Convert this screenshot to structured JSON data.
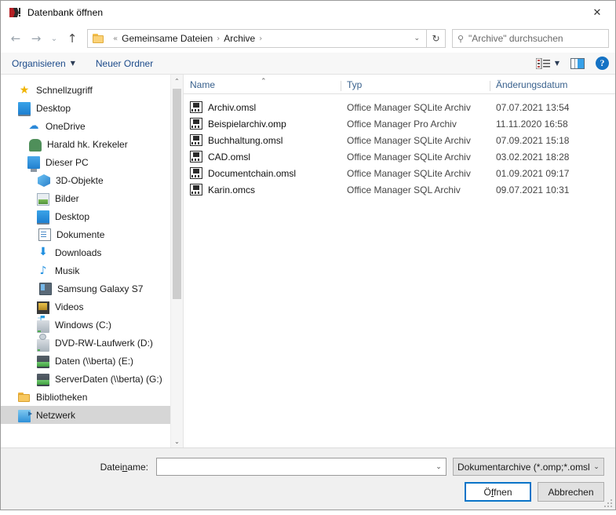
{
  "window": {
    "title": "Datenbank öffnen",
    "app_icon": "office-manager-icon",
    "close_label": "✕"
  },
  "nav": {
    "back_label": "←",
    "forward_label": "→",
    "recent_label": "⌄",
    "up_label": "↑",
    "refresh_label": "↻",
    "dropdown_label": "⌄",
    "breadcrumb": {
      "overflow": "«",
      "separator": "›",
      "items": [
        "Gemeinsame Dateien",
        "Archive"
      ]
    }
  },
  "search": {
    "placeholder": "\"Archive\" durchsuchen",
    "value": "",
    "icon": "search-icon"
  },
  "toolbar": {
    "organize_label": "Organisieren",
    "organize_caret": "▼",
    "new_folder_label": "Neuer Ordner",
    "view_options_icon": "view-options-icon",
    "view_caret": "▼",
    "preview_pane_icon": "preview-pane-icon",
    "help_label": "?"
  },
  "sidebar": {
    "scroll_up": "⌃",
    "scroll_down": "⌄",
    "items": [
      {
        "label": "Schnellzugriff",
        "icon": "quick-access-star-icon",
        "level": 0,
        "selected": false
      },
      {
        "label": "Desktop",
        "icon": "desktop-monitor-icon",
        "level": 0,
        "selected": false
      },
      {
        "label": "OneDrive",
        "icon": "onedrive-cloud-icon",
        "level": 1,
        "selected": false
      },
      {
        "label": "Harald hk. Krekeler",
        "icon": "user-person-icon",
        "level": 1,
        "selected": false
      },
      {
        "label": "Dieser PC",
        "icon": "this-pc-icon",
        "level": 1,
        "selected": false
      },
      {
        "label": "3D-Objekte",
        "icon": "3d-objects-icon",
        "level": 2,
        "selected": false
      },
      {
        "label": "Bilder",
        "icon": "pictures-icon",
        "level": 2,
        "selected": false
      },
      {
        "label": "Desktop",
        "icon": "desktop-monitor-icon",
        "level": 2,
        "selected": false
      },
      {
        "label": "Dokumente",
        "icon": "documents-icon",
        "level": 2,
        "selected": false
      },
      {
        "label": "Downloads",
        "icon": "downloads-arrow-icon",
        "level": 2,
        "selected": false
      },
      {
        "label": "Musik",
        "icon": "music-note-icon",
        "level": 2,
        "selected": false
      },
      {
        "label": "Samsung Galaxy S7",
        "icon": "phone-icon",
        "level": 2,
        "selected": false
      },
      {
        "label": "Videos",
        "icon": "videos-icon",
        "level": 2,
        "selected": false
      },
      {
        "label": "Windows (C:)",
        "icon": "windows-drive-icon",
        "level": 2,
        "selected": false
      },
      {
        "label": "DVD-RW-Laufwerk (D:)",
        "icon": "dvd-drive-icon",
        "level": 2,
        "selected": false
      },
      {
        "label": "Daten (\\\\berta) (E:)",
        "icon": "network-drive-icon",
        "level": 2,
        "selected": false
      },
      {
        "label": "ServerDaten (\\\\berta) (G:)",
        "icon": "network-drive-icon",
        "level": 2,
        "selected": false
      },
      {
        "label": "Bibliotheken",
        "icon": "libraries-folder-icon",
        "level": 0,
        "selected": false
      },
      {
        "label": "Netzwerk",
        "icon": "network-icon",
        "level": 0,
        "selected": true
      }
    ]
  },
  "filelist": {
    "columns": [
      "Name",
      "Typ",
      "Änderungsdatum"
    ],
    "sort_column": "Name",
    "sort_indicator": "⌃",
    "rows": [
      {
        "name": "Archiv.omsl",
        "typ": "Office Manager SQLite Archiv",
        "date": "07.07.2021 13:54",
        "icon": "archive-file-icon"
      },
      {
        "name": "Beispielarchiv.omp",
        "typ": "Office Manager Pro Archiv",
        "date": "11.11.2020 16:58",
        "icon": "archive-file-icon"
      },
      {
        "name": "Buchhaltung.omsl",
        "typ": "Office Manager SQLite Archiv",
        "date": "07.09.2021 15:18",
        "icon": "archive-file-icon"
      },
      {
        "name": "CAD.omsl",
        "typ": "Office Manager SQLite Archiv",
        "date": "03.02.2021 18:28",
        "icon": "archive-file-icon"
      },
      {
        "name": "Documentchain.omsl",
        "typ": "Office Manager SQLite Archiv",
        "date": "01.09.2021 09:17",
        "icon": "archive-file-icon"
      },
      {
        "name": "Karin.omcs",
        "typ": "Office Manager SQL Archiv",
        "date": "09.07.2021 10:31",
        "icon": "archive-file-icon"
      }
    ]
  },
  "footer": {
    "filename_label_pre": "Datei",
    "filename_label_accel": "n",
    "filename_label_post": "ame:",
    "filename_value": "",
    "filename_placeholder": "",
    "filename_caret": "⌄",
    "filter_value": "Dokumentarchive (*.omp;*.omsl",
    "filter_caret": "⌄",
    "open_button_pre": "Ö",
    "open_button_accel": "f",
    "open_button_post": "fnen",
    "cancel_button": "Abbrechen"
  },
  "colors": {
    "accent": "#0a74c8",
    "link": "#1b4a8a",
    "selection": "#d6d6d6",
    "header_text": "#39618d"
  }
}
